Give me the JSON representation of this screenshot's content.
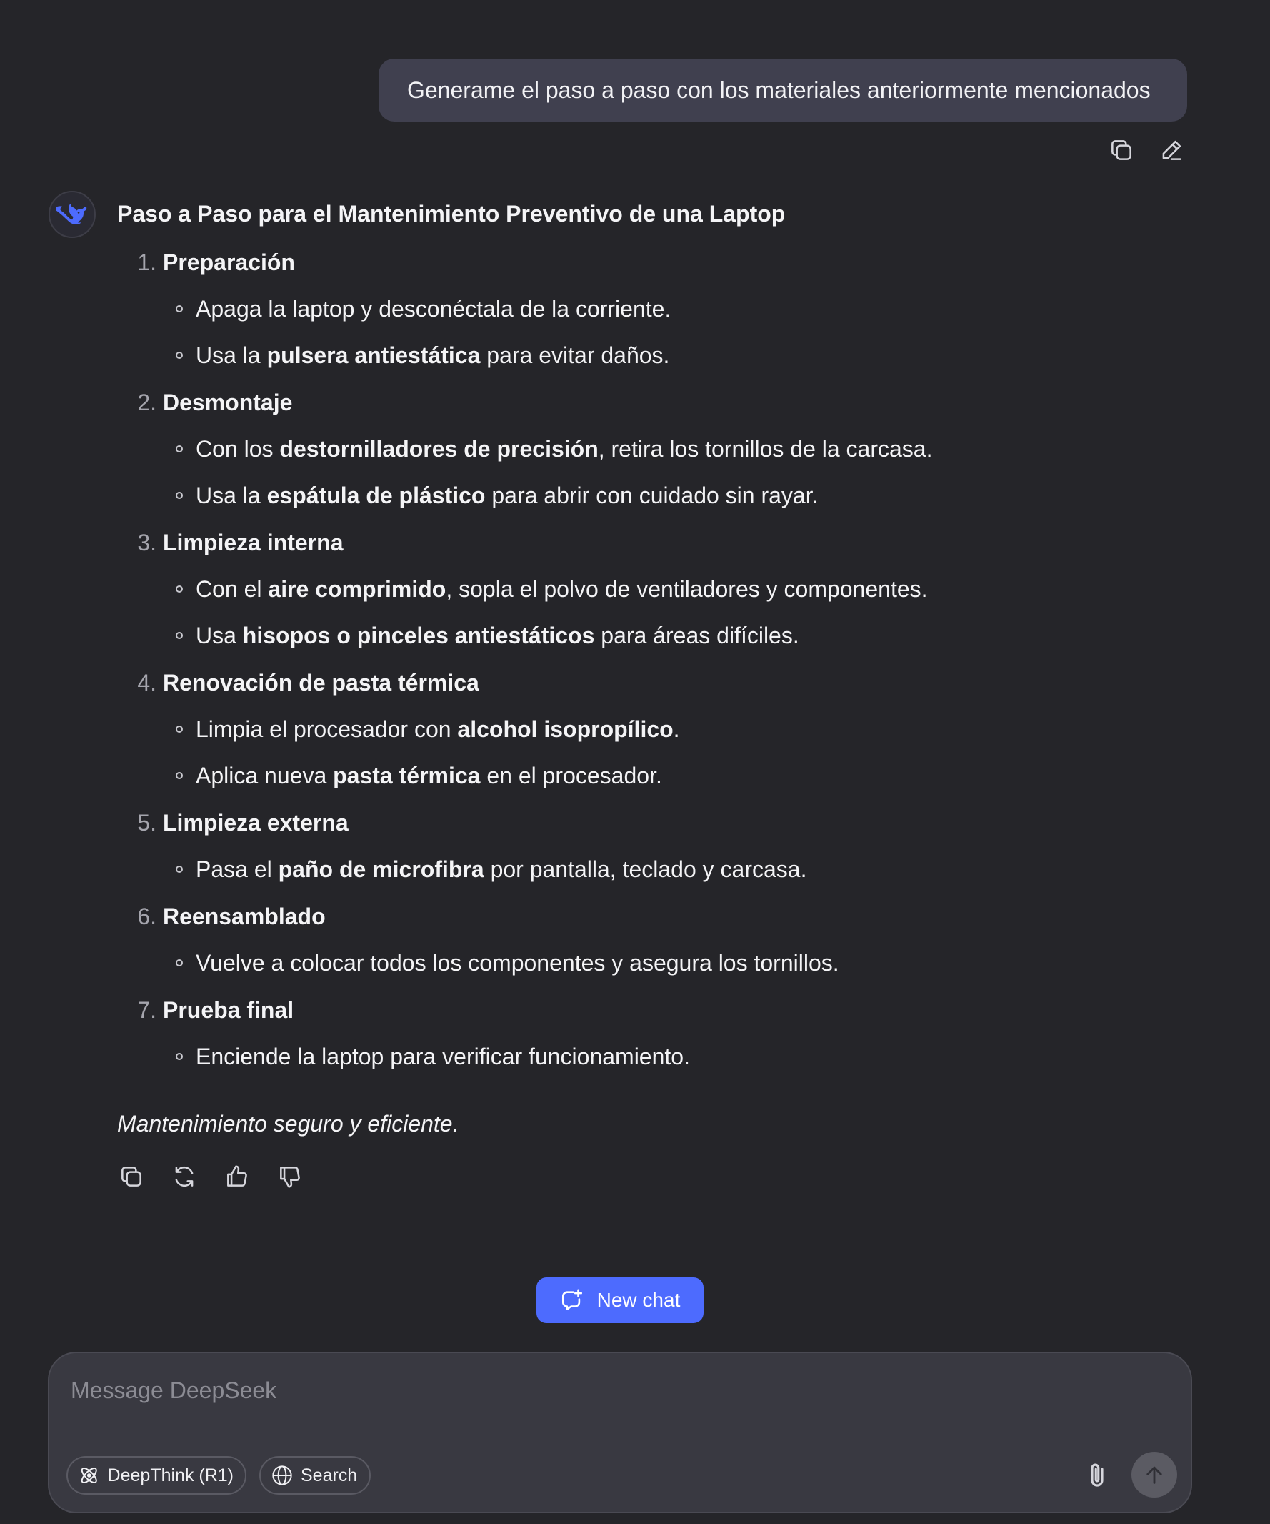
{
  "user_message": "Generame el paso a paso con los materiales anteriormente mencionados",
  "answer": {
    "title": "Paso a Paso para el Mantenimiento Preventivo de una Laptop",
    "steps": [
      {
        "num": "1.",
        "label": "Preparación",
        "subs": [
          [
            {
              "t": "Apaga la laptop y desconéctala de la corriente.",
              "b": false
            }
          ],
          [
            {
              "t": "Usa la ",
              "b": false
            },
            {
              "t": "pulsera antiestática",
              "b": true
            },
            {
              "t": " para evitar daños.",
              "b": false
            }
          ]
        ]
      },
      {
        "num": "2.",
        "label": "Desmontaje",
        "subs": [
          [
            {
              "t": "Con los ",
              "b": false
            },
            {
              "t": "destornilladores de precisión",
              "b": true
            },
            {
              "t": ", retira los tornillos de la carcasa.",
              "b": false
            }
          ],
          [
            {
              "t": "Usa la ",
              "b": false
            },
            {
              "t": "espátula de plástico",
              "b": true
            },
            {
              "t": " para abrir con cuidado sin rayar.",
              "b": false
            }
          ]
        ]
      },
      {
        "num": "3.",
        "label": "Limpieza interna",
        "subs": [
          [
            {
              "t": "Con el ",
              "b": false
            },
            {
              "t": "aire comprimido",
              "b": true
            },
            {
              "t": ", sopla el polvo de ventiladores y componentes.",
              "b": false
            }
          ],
          [
            {
              "t": "Usa ",
              "b": false
            },
            {
              "t": "hisopos o pinceles antiestáticos",
              "b": true
            },
            {
              "t": " para áreas difíciles.",
              "b": false
            }
          ]
        ]
      },
      {
        "num": "4.",
        "label": "Renovación de pasta térmica",
        "subs": [
          [
            {
              "t": "Limpia el procesador con ",
              "b": false
            },
            {
              "t": "alcohol isopropílico",
              "b": true
            },
            {
              "t": ".",
              "b": false
            }
          ],
          [
            {
              "t": "Aplica nueva ",
              "b": false
            },
            {
              "t": "pasta térmica",
              "b": true
            },
            {
              "t": " en el procesador.",
              "b": false
            }
          ]
        ]
      },
      {
        "num": "5.",
        "label": "Limpieza externa",
        "subs": [
          [
            {
              "t": "Pasa el ",
              "b": false
            },
            {
              "t": "paño de microfibra",
              "b": true
            },
            {
              "t": " por pantalla, teclado y carcasa.",
              "b": false
            }
          ]
        ]
      },
      {
        "num": "6.",
        "label": "Reensamblado",
        "subs": [
          [
            {
              "t": "Vuelve a colocar todos los componentes y asegura los tornillos.",
              "b": false
            }
          ]
        ]
      },
      {
        "num": "7.",
        "label": "Prueba final",
        "subs": [
          [
            {
              "t": "Enciende la laptop para verificar funcionamiento.",
              "b": false
            }
          ]
        ]
      }
    ],
    "closing": "Mantenimiento seguro y eficiente."
  },
  "new_chat": {
    "label": "New chat"
  },
  "composer": {
    "placeholder": "Message DeepSeek",
    "deepthink_label": "DeepThink (R1)",
    "search_label": "Search"
  },
  "colors": {
    "background": "#252529",
    "user_bubble": "#40404f",
    "accent": "#4d6bfe",
    "composer": "#393941"
  },
  "icons": {
    "user_actions": [
      "copy-icon",
      "edit-icon"
    ],
    "answer_actions": [
      "copy-icon",
      "regenerate-icon",
      "thumbs-up-icon",
      "thumbs-down-icon"
    ],
    "avatar": "deepseek-whale-icon"
  }
}
